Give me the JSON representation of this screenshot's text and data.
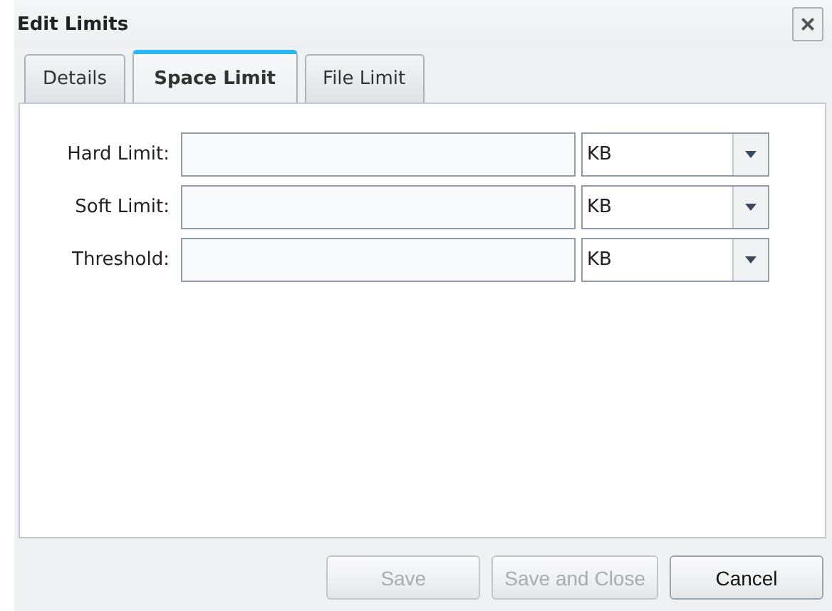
{
  "window": {
    "title": "Edit Limits",
    "close": "×"
  },
  "tabs": [
    {
      "label": "Details",
      "selected": false
    },
    {
      "label": "Space Limit",
      "selected": true
    },
    {
      "label": "File Limit",
      "selected": false
    }
  ],
  "fields": [
    {
      "label": "Hard Limit:",
      "unit": "KB"
    },
    {
      "label": "Soft Limit:",
      "unit": "KB"
    },
    {
      "label": "Threshold:",
      "unit": "KB"
    }
  ],
  "buttons": [
    {
      "label": "Save",
      "disabled": true
    },
    {
      "label": "Save and Close",
      "disabled": true
    },
    {
      "label": "Cancel",
      "disabled": false
    }
  ]
}
